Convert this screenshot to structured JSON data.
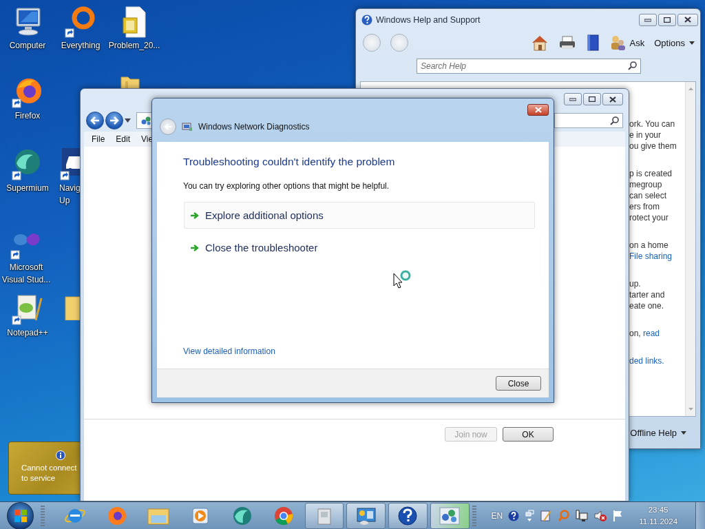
{
  "desktop_icons": [
    {
      "lines": [
        "Computer"
      ]
    },
    {
      "lines": [
        "Everything"
      ]
    },
    {
      "lines": [
        "Problem_20..."
      ]
    },
    {
      "lines": [
        "Firefox"
      ]
    },
    {
      "lines": [
        "Supermium"
      ]
    },
    {
      "lines": [
        "Navig",
        "Up"
      ]
    },
    {
      "lines": [
        "Microsoft",
        "Visual Stud..."
      ]
    },
    {
      "lines": [
        "Notepad++"
      ]
    }
  ],
  "notification": {
    "lines": [
      "Cannot connect",
      "to service"
    ]
  },
  "help_window": {
    "title": "Windows Help and Support",
    "ask": "Ask",
    "options": "Options",
    "search": {
      "placeholder": "Search Help"
    },
    "paragraphs": [
      [
        [
          {
            "text": "ork. You can",
            "link": false
          }
        ],
        [
          {
            "text": "e in your",
            "link": false
          }
        ],
        [
          {
            "text": "ou give them",
            "link": false
          }
        ]
      ],
      [
        [
          {
            "text": "p is created",
            "link": false
          }
        ],
        [
          {
            "text": "megroup",
            "link": false
          }
        ],
        [
          {
            "text": "can select",
            "link": false
          }
        ],
        [
          {
            "text": "ers from",
            "link": false
          }
        ],
        [
          {
            "text": "rotect your",
            "link": false
          }
        ]
      ],
      [
        [
          {
            "text": "on a home",
            "link": false
          }
        ],
        [
          {
            "text": "File sharing",
            "link": true
          }
        ]
      ],
      [
        [
          {
            "text": "up.",
            "link": false
          }
        ],
        [
          {
            "text": "tarter and",
            "link": false
          }
        ],
        [
          {
            "text": "eate one.",
            "link": false
          }
        ]
      ],
      [
        [
          {
            "text": "on, ",
            "link": false
          },
          {
            "text": "read",
            "link": true
          }
        ]
      ],
      [
        [
          {
            "text": "ded links.",
            "link": true
          }
        ]
      ]
    ],
    "footer": "Offline Help"
  },
  "explorer_window": {
    "menu": [
      "File",
      "Edit",
      "Vie"
    ],
    "buttons": [
      {
        "label": "Join now",
        "disabled": true
      },
      {
        "label": "OK",
        "disabled": false
      }
    ]
  },
  "dialog": {
    "title": "Windows Network Diagnostics",
    "heading": "Troubleshooting couldn't identify the problem",
    "subtext": "You can try exploring other options that might be helpful.",
    "options": [
      {
        "label": "Explore additional options",
        "selected": true
      },
      {
        "label": "Close the troubleshooter",
        "selected": false
      }
    ],
    "details_link": "View detailed information",
    "close_button": "Close"
  },
  "taskbar": {
    "language": "EN",
    "time": "23:45",
    "date": "11.11.2024"
  }
}
